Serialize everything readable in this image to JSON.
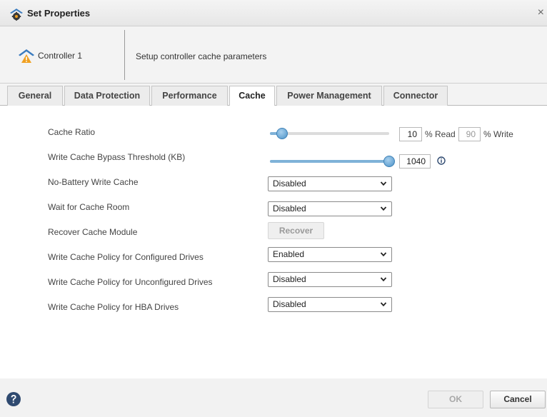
{
  "window": {
    "title": "Set Properties",
    "close_glyph": "×",
    "icon": "gear-cloud-icon"
  },
  "header": {
    "controller_name": "Controller 1",
    "controller_icon": "controller-warning-icon",
    "description": "Setup controller cache parameters"
  },
  "tabs": [
    {
      "label": "General",
      "active": false
    },
    {
      "label": "Data Protection",
      "active": false
    },
    {
      "label": "Performance",
      "active": false
    },
    {
      "label": "Cache",
      "active": true
    },
    {
      "label": "Power Management",
      "active": false
    },
    {
      "label": "Connector",
      "active": false
    }
  ],
  "cache": {
    "cache_ratio": {
      "label": "Cache Ratio",
      "read_value": "10",
      "read_suffix": "% Read",
      "write_value": "90",
      "write_suffix": "% Write",
      "slider_fraction": 0.1
    },
    "bypass_threshold": {
      "label": "Write Cache Bypass Threshold (KB)",
      "value": "1040",
      "slider_fraction": 1.0,
      "info_icon": "info-icon"
    },
    "no_battery_write_cache": {
      "label": "No-Battery Write Cache",
      "value": "Disabled"
    },
    "wait_for_cache_room": {
      "label": "Wait for Cache Room",
      "value": "Disabled"
    },
    "recover_cache_module": {
      "label": "Recover Cache Module",
      "button_label": "Recover"
    },
    "policy_configured": {
      "label": "Write Cache Policy for Configured Drives",
      "value": "Enabled"
    },
    "policy_unconfigured": {
      "label": "Write Cache Policy for Unconfigured Drives",
      "value": "Disabled"
    },
    "policy_hba": {
      "label": "Write Cache Policy for HBA Drives",
      "value": "Disabled"
    }
  },
  "footer": {
    "help_icon": "help-icon",
    "ok_label": "OK",
    "cancel_label": "Cancel"
  },
  "colors": {
    "slider_thumb": "#4d93c8",
    "slider_fill": "#7fb2d8",
    "help_icon": "#2f4a70",
    "warning": "#f0a020"
  }
}
